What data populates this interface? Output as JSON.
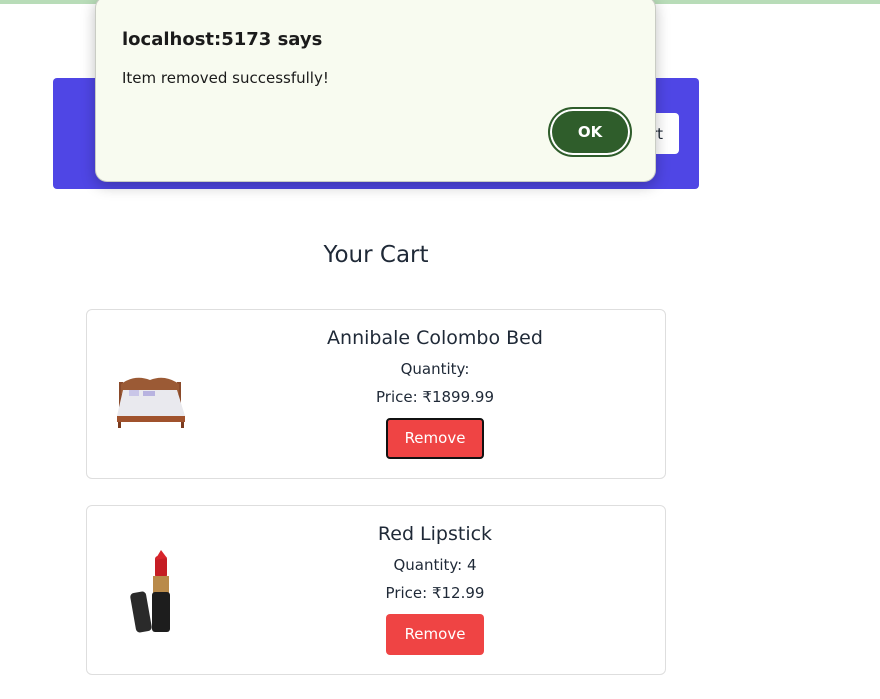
{
  "dialog": {
    "title": "localhost:5173 says",
    "message": "Item removed successfully!",
    "ok_label": "OK"
  },
  "navbar": {
    "button_label": "Cart"
  },
  "cart": {
    "title": "Your Cart",
    "items": [
      {
        "name": "Annibale Colombo Bed",
        "quantity_text": "Quantity:",
        "price_text": "Price: ₹1899.99",
        "remove_label": "Remove",
        "image_icon": "bed-image"
      },
      {
        "name": "Red Lipstick",
        "quantity_text": "Quantity: 4",
        "price_text": "Price: ₹12.99",
        "remove_label": "Remove",
        "image_icon": "lipstick-image"
      }
    ]
  },
  "colors": {
    "navbar": "#4f46e5",
    "remove_button": "#ef4444",
    "ok_button": "#2f5d2b",
    "dialog_bg": "#f8fbf0"
  }
}
